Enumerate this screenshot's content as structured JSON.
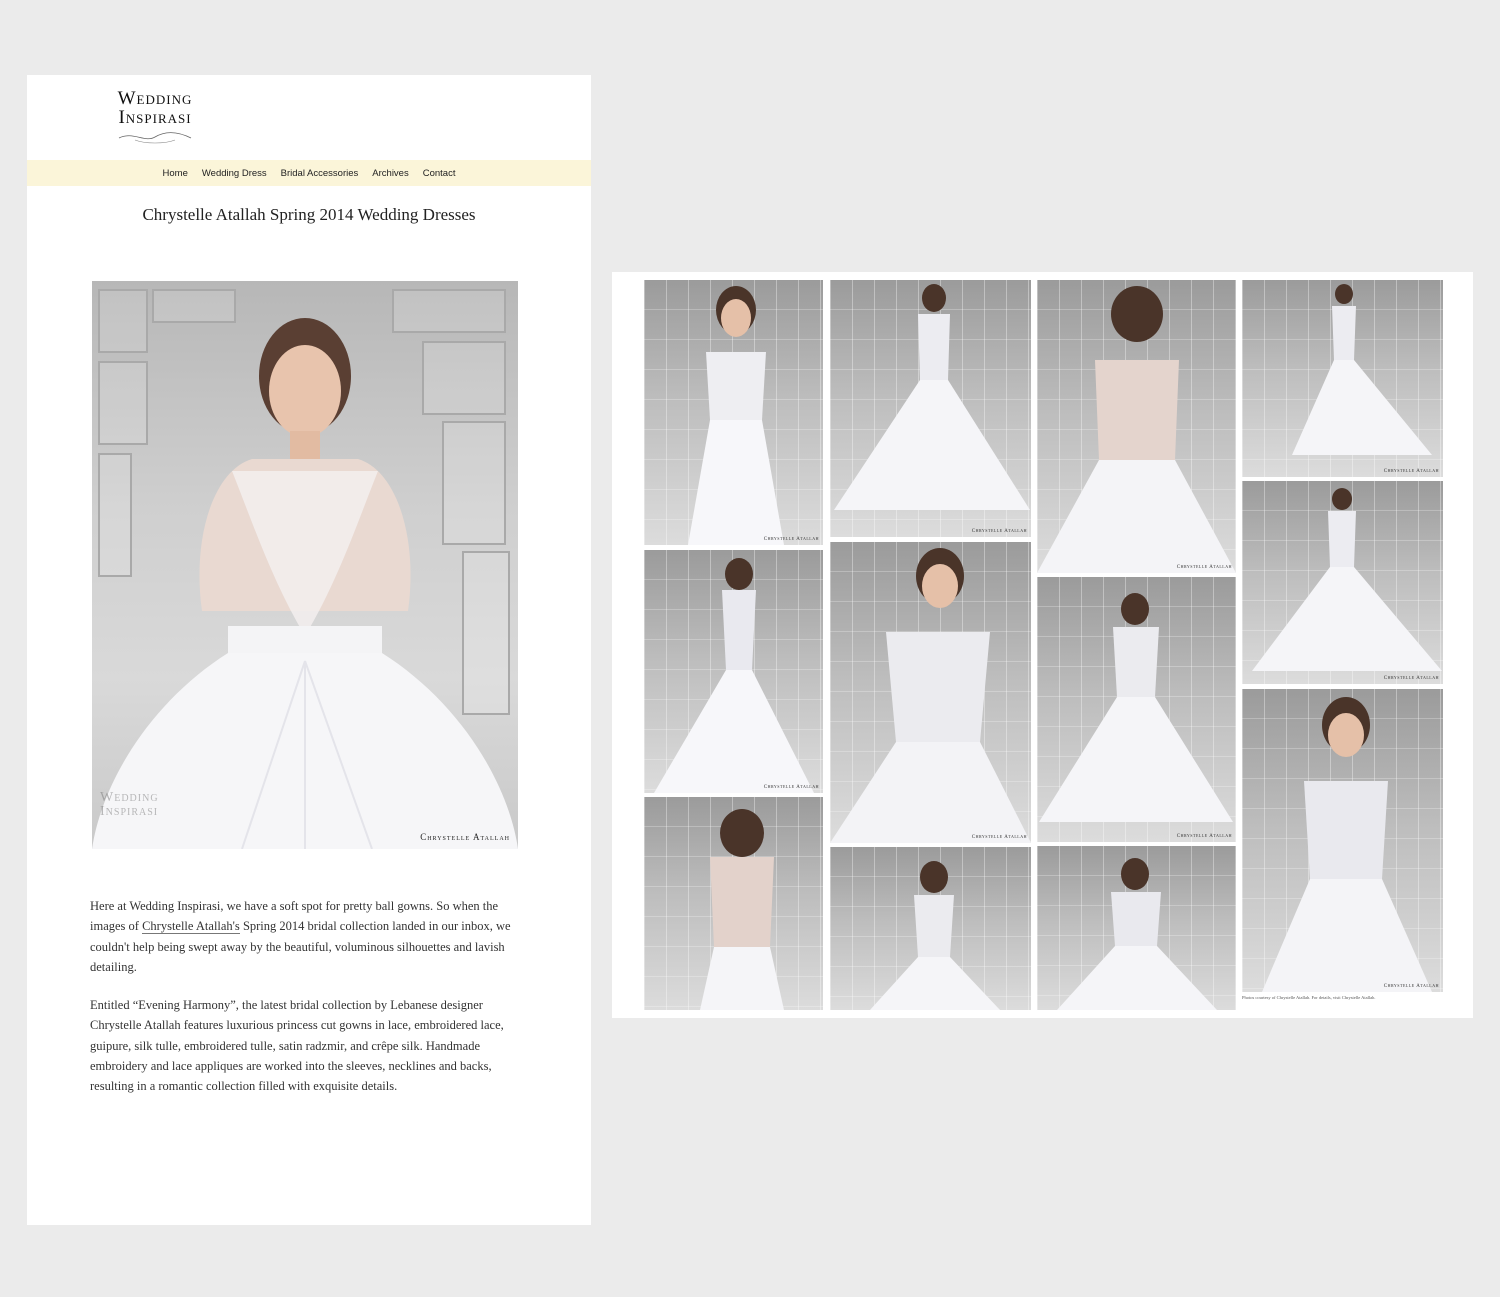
{
  "site": {
    "logo_line1": "Wedding",
    "logo_line2": "Inspirasi"
  },
  "nav": {
    "items": [
      {
        "label": "Home"
      },
      {
        "label": "Wedding Dress"
      },
      {
        "label": "Bridal Accessories"
      },
      {
        "label": "Archives"
      },
      {
        "label": "Contact"
      }
    ]
  },
  "post": {
    "title": "Chrystelle Atallah Spring 2014 Wedding Dresses",
    "hero_credit": "Chrystelle Atallah",
    "hero_watermark_1": "Wedding",
    "hero_watermark_2": "Inspirasi",
    "para1_a": "Here at Wedding Inspirasi, we have a soft spot for pretty ball gowns. So when the images of ",
    "para1_link": "Chrystelle Atallah's",
    "para1_b": " Spring 2014 bridal collection landed in our inbox, we couldn't help being swept away by the beautiful, voluminous silhouettes and lavish detailing.",
    "para2": "Entitled “Evening Harmony”, the latest bridal collection by Lebanese designer Chrystelle Atallah features luxurious princess cut gowns in lace, embroidered lace, guipure, silk tulle, embroidered tulle, satin radzmir, and crêpe silk. Handmade embroidery and lace appliques are worked into the sleeves, necklines and backs, resulting in a romantic collection filled with exquisite details."
  },
  "gallery": {
    "tile_credit": "Chrystelle Atallah",
    "caption": "Photos courtesy of Chrystelle Atallah. For details, visit Chrystelle Atallah."
  },
  "colors": {
    "nav_bg": "#fbf5d9",
    "page_bg": "#ebebeb"
  }
}
